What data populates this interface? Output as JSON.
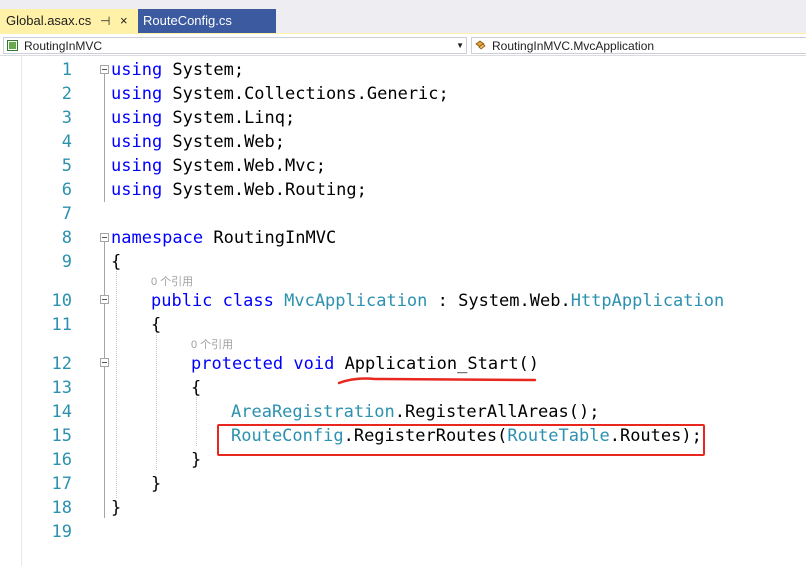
{
  "tabs": [
    {
      "label": "Global.asax.cs",
      "active": true,
      "pin": "⊣",
      "close": "×"
    },
    {
      "label": "RouteConfig.cs",
      "active": false
    }
  ],
  "navbar": {
    "project": "RoutingInMVC",
    "member": "RoutingInMVC.MvcApplication"
  },
  "line_numbers": [
    "1",
    "2",
    "3",
    "4",
    "5",
    "6",
    "7",
    "8",
    "9",
    "10",
    "11",
    "12",
    "13",
    "14",
    "15",
    "16",
    "17",
    "18",
    "19"
  ],
  "code": {
    "l1": {
      "kw": "using",
      "rest": " System;"
    },
    "l2": {
      "kw": "using",
      "rest": " System.Collections.Generic;"
    },
    "l3": {
      "kw": "using",
      "rest": " System.Linq;"
    },
    "l4": {
      "kw": "using",
      "rest": " System.Web;"
    },
    "l5": {
      "kw": "using",
      "rest": " System.Web.Mvc;"
    },
    "l6": {
      "kw": "using",
      "rest": " System.Web.Routing;"
    },
    "l8": {
      "kw": "namespace",
      "rest": " RoutingInMVC"
    },
    "l9": "{",
    "ref10": "0 个引用",
    "l10": {
      "kw1": "public",
      "kw2": "class",
      "type": "MvcApplication",
      "mid": " : System.Web.",
      "type2": "HttpApplication"
    },
    "l11": "{",
    "ref12": "0 个引用",
    "l12": {
      "kw1": "protected",
      "kw2": "void",
      "rest": " Application_Start()"
    },
    "l13": "{",
    "l14": {
      "type": "AreaRegistration",
      "rest": ".RegisterAllAreas();"
    },
    "l15": {
      "type": "RouteConfig",
      "mid": ".RegisterRoutes(",
      "type2": "RouteTable",
      "rest": ".Routes);"
    },
    "l16": "}",
    "l17": "}",
    "l18": "}"
  },
  "colors": {
    "keyword": "#0000ff",
    "type": "#2b91af",
    "line_number": "#2b91af",
    "annotation": "#e8271f",
    "active_tab": "#fff1a8",
    "inactive_tab": "#3b5aa0"
  }
}
